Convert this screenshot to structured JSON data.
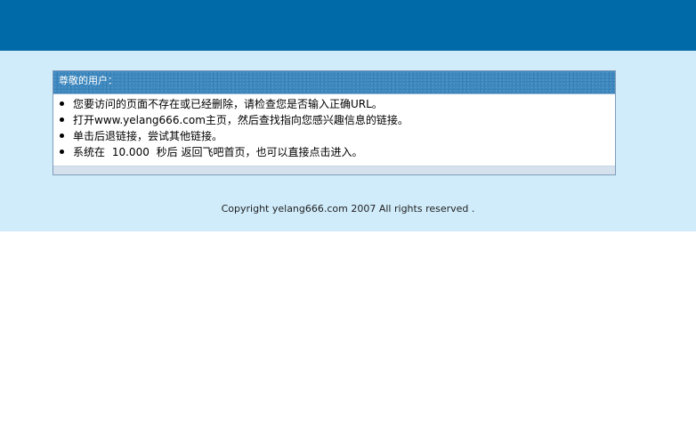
{
  "header": {
    "background_color": "#006aa8"
  },
  "notice": {
    "title": "尊敬的用户：",
    "items": [
      {
        "text": "您要访问的页面不存在或已经删除，请检查您是否输入正确URL。"
      },
      {
        "text": "打开www.yelang666.com主页，然后查找指向您感兴趣信息的链接。"
      },
      {
        "text": "单击后退链接，尝试其他链接。"
      }
    ],
    "redirect": {
      "prefix": "系统在",
      "seconds": "10.000",
      "suffix": "秒后 返回飞吧首页，也可以直接点击进入。"
    }
  },
  "footer": {
    "copyright": "Copyright yelang666.com 2007 All rights reserved ."
  },
  "colors": {
    "band": "#d0ecfb",
    "header_strip": "#3b87be"
  }
}
